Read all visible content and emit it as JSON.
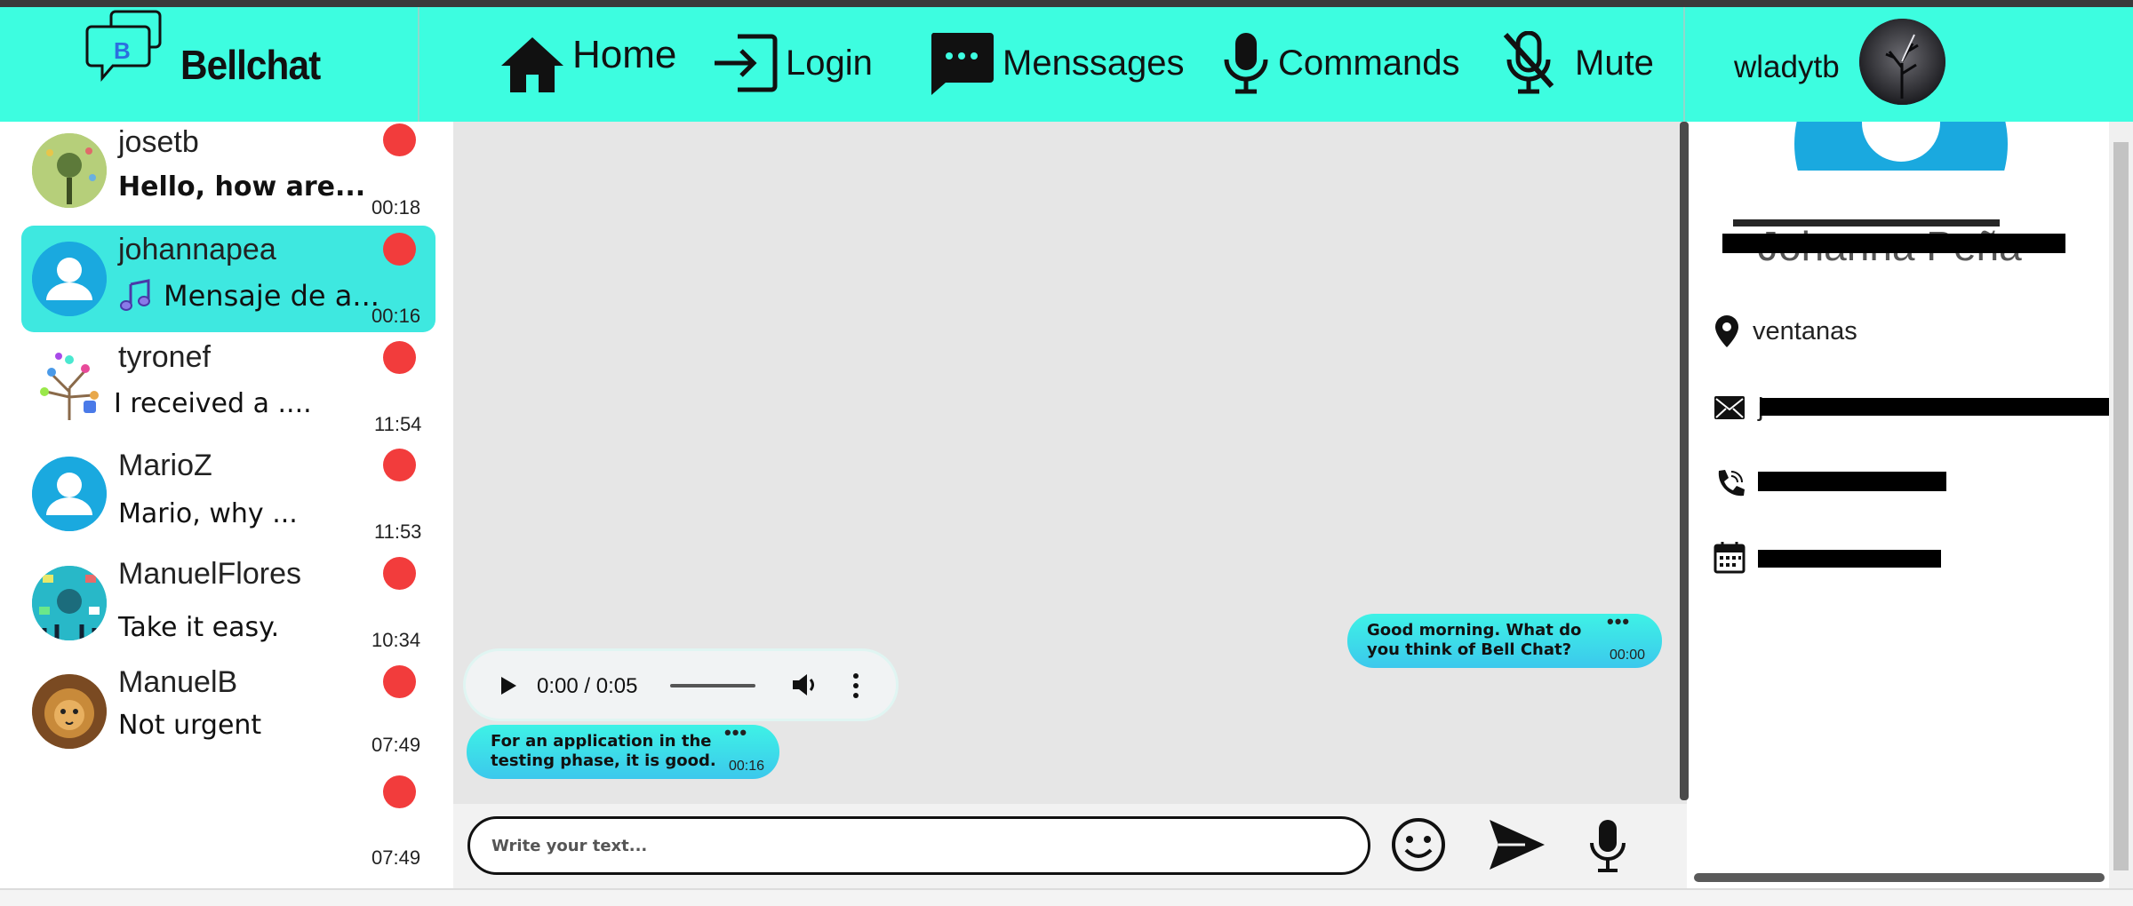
{
  "app": {
    "name": "Bellchat",
    "logo_letter": "B",
    "brand_color": "#3dfde0"
  },
  "nav": {
    "items": [
      {
        "label": "Home",
        "icon": "home-icon"
      },
      {
        "label": "Login",
        "icon": "login-icon"
      },
      {
        "label": "Menssages",
        "icon": "messages-icon"
      },
      {
        "label": "Commands",
        "icon": "microphone-icon"
      },
      {
        "label": "Mute",
        "icon": "mic-off-icon"
      }
    ]
  },
  "user": {
    "name": "wladytb"
  },
  "contacts": [
    {
      "name": "josetb",
      "message": "Hello, how are...",
      "time": "00:18",
      "bold": true,
      "unread_color": "#f23c3c"
    },
    {
      "name": "johannapea",
      "message": "Mensaje de a...",
      "message_icon": "music-note-icon",
      "time": "00:16",
      "active": true,
      "unread_color": "#f23c3c"
    },
    {
      "name": "tyronef",
      "message": "I received a ....",
      "time": "11:54",
      "unread_color": "#f23c3c"
    },
    {
      "name": "MarioZ",
      "message": "Mario, why ...",
      "time": "11:53",
      "unread_color": "#f23c3c"
    },
    {
      "name": "ManuelFlores",
      "message": "Take it easy.",
      "time": "10:34",
      "unread_color": "#f23c3c"
    },
    {
      "name": "ManuelB",
      "message": "Not urgent",
      "time": "07:49",
      "unread_color": "#f23c3c"
    },
    {
      "name": "",
      "message": "",
      "time": "07:49",
      "unread_color": "#f23c3c"
    }
  ],
  "chat": {
    "messages": [
      {
        "direction": "out",
        "text": "Good morning. What do you think  of Bell Chat?",
        "dots": "•••",
        "time": "00:00"
      },
      {
        "direction": "in",
        "type": "audio",
        "audio_time": "0:00 / 0:05"
      },
      {
        "direction": "in",
        "text": "For an application in the testing phase, it is good.",
        "dots": "•••",
        "time": "00:16"
      }
    ],
    "input_placeholder": "Write your text...",
    "emoji_icon": "smiley-icon",
    "send_icon": "send-icon",
    "mic_icon": "microphone-icon"
  },
  "profile": {
    "name": "Johanna Peña",
    "location": "ventanas",
    "email": "j",
    "phone": "",
    "date": ""
  }
}
